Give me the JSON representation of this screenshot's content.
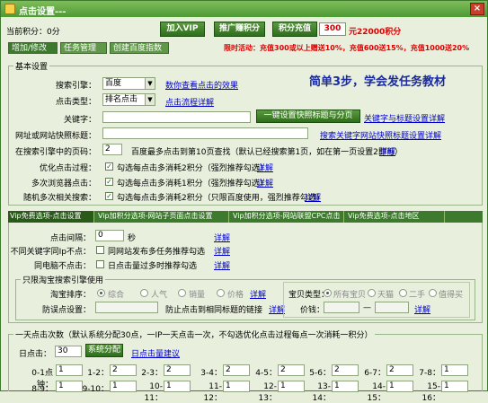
{
  "window": {
    "title": "点击设置---",
    "close_label": "×"
  },
  "header": {
    "current_points": "当前积分：0分",
    "join_vip": "加入VIP",
    "promote_points": "推广赚积分",
    "recharge_points": "积分充值",
    "recharge_amount": "300",
    "recharge_suffix": "元22000积分",
    "promo": "限时活动：充值300或以上赠送10%，充值600送15%，充值1000送20%"
  },
  "tabs": [
    {
      "label": "增加/修改"
    },
    {
      "label": "任务管理"
    },
    {
      "label": "创建百度指数"
    }
  ],
  "basic": {
    "group_label": "基本设置",
    "engine_label": "搜索引擎：",
    "engine_value": "百度",
    "engine_link": "数你查看点击的效果",
    "click_type_label": "点击类型：",
    "click_type_value": "排名点击",
    "click_type_link": "点击流程详解",
    "keyword_label": "关键字：",
    "keyword_value": "",
    "keyword_btn": "一键设置快照标题与分页",
    "keyword_link": "关键字与标题设置详解",
    "url_label": "网址或网站快照标题：",
    "url_value": "",
    "url_link": "搜索关键字网站快照标题设置详解",
    "page_label": "在搜索引擎中的页码：",
    "page_value": "2",
    "page_note": "百度最多点击到第10页查找（默认已经搜索第1页，如在第一页设置2即可）",
    "page_link": "详解",
    "slogan": "简单3步，学会发任务教材",
    "opt1_label": "优化点击过程：",
    "opt1_text": "勾选每点击多消耗2积分（强烈推荐勾选）",
    "opt1_link": "详解",
    "opt2_label": "多次浏览器点击：",
    "opt2_text": "勾选每点击多消耗1积分（强烈推荐勾选）",
    "opt2_link": "详解",
    "opt3_label": "随机多次相关搜索：",
    "opt3_text": "勾选每点击多消耗2积分（只限百度使用，强烈推荐勾选）",
    "opt3_link": "详解"
  },
  "vip_tabs": [
    {
      "label": "Vip免费选项-点击设置"
    },
    {
      "label": "Vip加积分选项-网站子页面点击设置"
    },
    {
      "label": "Vip加积分选项-网站联盟CPC点击"
    },
    {
      "label": "Vip免费选项-点击地区"
    }
  ],
  "vip": {
    "interval_label": "点击间隔：",
    "interval_value": "0",
    "interval_unit": "秒",
    "interval_link": "详解",
    "ip_label": "不同关键字同Ip不点：",
    "ip_text": "同网站发布多任务推荐勾选",
    "ip_link": "详解",
    "same_label": "同电脑不点击：",
    "same_text": "日点击量过多时推荐勾选",
    "same_link": "详解"
  },
  "taobao": {
    "group_label": "只限淘宝搜索引擎使用",
    "sort_label": "淘宝排序：",
    "sort_options": [
      "综合",
      "人气",
      "销量",
      "价格"
    ],
    "sort_link": "详解",
    "anti_label": "防误点设置：",
    "anti_value": "",
    "anti_note": "防止点击到相同标题的链接",
    "anti_link": "详解",
    "type_label": "宝贝类型：",
    "type_options": [
      "所有宝贝",
      "天猫",
      "二手",
      "值得买"
    ],
    "price_label": "价钱：",
    "price_dash": "—",
    "price_link": "详解"
  },
  "daily": {
    "group_label": "一天点击次数（默认系统分配30点，一IP一天点击一次，不勾选优化点击过程每点一次消耗一积分）",
    "clicks_label": "日点击：",
    "clicks_value": "30",
    "allocate_btn": "系统分配",
    "suggest_link": "日点击量建议",
    "row1": [
      {
        "label": "0-1点钟：",
        "value": "1"
      },
      {
        "label": "1-2：",
        "value": "2"
      },
      {
        "label": "2-3：",
        "value": "2"
      },
      {
        "label": "3-4：",
        "value": "2"
      },
      {
        "label": "4-5：",
        "value": "2"
      },
      {
        "label": "5-6：",
        "value": "2"
      },
      {
        "label": "6-7：",
        "value": "2"
      },
      {
        "label": "7-8：",
        "value": "1"
      }
    ],
    "row2": [
      {
        "label": "8-9：",
        "value": "1"
      },
      {
        "label": "9-10：",
        "value": "1"
      },
      {
        "label": "10-11：",
        "value": "1"
      },
      {
        "label": "11-12：",
        "value": "1"
      },
      {
        "label": "12-13：",
        "value": "1"
      },
      {
        "label": "13-14：",
        "value": "1"
      },
      {
        "label": "14-15：",
        "value": "1"
      },
      {
        "label": "15-16：",
        "value": "1"
      }
    ]
  }
}
